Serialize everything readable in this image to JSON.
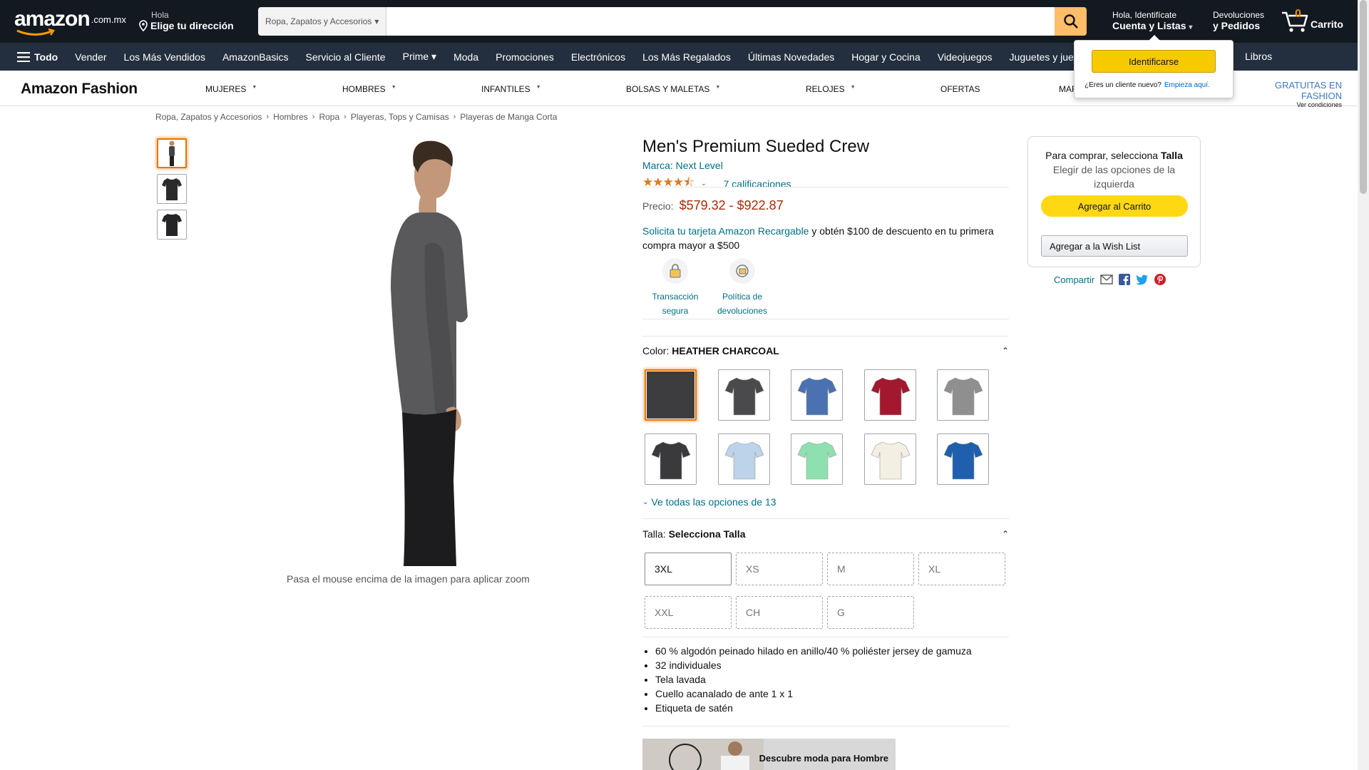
{
  "header": {
    "logo_text": "amazon",
    "logo_tld": ".com.mx",
    "address_small": "Hola",
    "address_big": "Elige tu dirección",
    "search_category": "Ropa, Zapatos y Accesorios",
    "search_placeholder": "",
    "account_small": "Hola, Identifícate",
    "account_big": "Cuenta y Listas",
    "returns_small": "Devoluciones",
    "returns_big": "y Pedidos",
    "cart_count": "0",
    "cart_label": "Carrito"
  },
  "nav": {
    "all_label": "Todo",
    "items": [
      "Vender",
      "Los Más Vendidos",
      "AmazonBasics",
      "Servicio al Cliente",
      "Prime ▾",
      "Moda",
      "Promociones",
      "Electrónicos",
      "Los Más Regalados",
      "Últimas Novedades",
      "Hogar y Cocina",
      "Videojuegos",
      "Juguetes y juegos"
    ],
    "last_item": "Libros"
  },
  "popover": {
    "signin_label": "Identificarse",
    "new_customer": "¿Eres un cliente nuevo?",
    "start_here": "Empieza aquí."
  },
  "fashion": {
    "logo": "Amazon Fashion",
    "menu": [
      "MUJERES",
      "HOMBRES",
      "INFANTILES",
      "BOLSAS Y MALETAS",
      "RELOJES",
      "OFERTAS",
      "MAR"
    ],
    "promo": "GRATUITAS EN FASHION",
    "promo_sub": "Ver condiciones"
  },
  "breadcrumb": [
    "Ropa, Zapatos y Accesorios",
    "Hombres",
    "Ropa",
    "Playeras, Tops y Camisas",
    "Playeras de Manga Corta"
  ],
  "image": {
    "zoom_hint": "Pasa el mouse encima de la imagen para aplicar zoom"
  },
  "product": {
    "title": "Men's Premium Sueded Crew",
    "brand": "Marca: Next Level",
    "rating": 4.5,
    "ratings_count": "7 calificaciones",
    "price_label": "Precio:",
    "price_range": "$579.32 - $922.87",
    "card_offer_link": "Solicita tu tarjeta Amazon Recargable",
    "card_offer_rest": " y obtén $100 de descuento en tu primera compra mayor a $500",
    "trust_1": "Transacción segura",
    "trust_2": "Política de devoluciones",
    "color_label": "Color: ",
    "color_value": "HEATHER CHARCOAL",
    "see_all": "Ve todas las opciones de 13",
    "size_label": "Talla: ",
    "size_value": "Selecciona Talla",
    "sizes": [
      "3XL",
      "XS",
      "M",
      "XL",
      "XXL",
      "CH",
      "G"
    ],
    "bullets": [
      "60 % algodón peinado hilado en anillo/40 % poliéster jersey de gamuza",
      "32 individuales",
      "Tela lavada",
      "Cuello acanalado de ante 1 x 1",
      "Etiqueta de satén"
    ],
    "banner_text": "Descubre moda para Hombre"
  },
  "swatches": [
    "#3d3d3f",
    "#4a4a4c",
    "#4a72b0",
    "#a3182e",
    "#8f8f8f",
    "#3a3a3c",
    "#bcd3ea",
    "#8fe0b0",
    "#f3efe2",
    "#1f5fae"
  ],
  "buybox": {
    "msg_prefix": "Para comprar, selecciona ",
    "msg_bold": "Talla",
    "msg_rest": "Elegir de las opciones de la izquierda",
    "add_to_cart": "Agregar al Carrito",
    "wish_list": "Agregar a la Wish List"
  },
  "share": {
    "label": "Compartir"
  }
}
